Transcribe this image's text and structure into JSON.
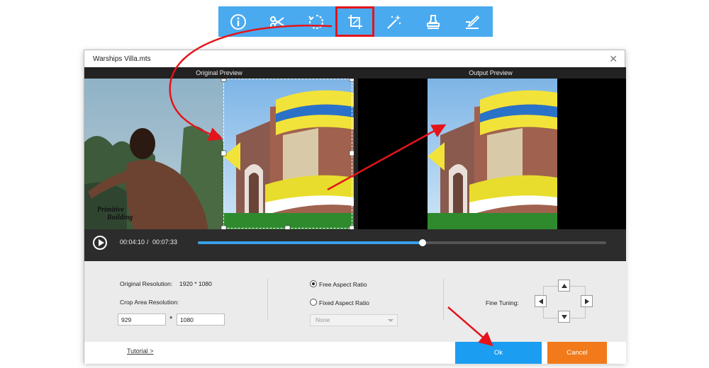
{
  "toolbar": {
    "tools": [
      {
        "icon": "info-icon"
      },
      {
        "icon": "scissors-icon"
      },
      {
        "icon": "rotate-icon"
      },
      {
        "icon": "crop-icon",
        "active": true
      },
      {
        "icon": "magic-wand-icon"
      },
      {
        "icon": "stamp-icon"
      },
      {
        "icon": "edit-subtitle-icon"
      }
    ],
    "bg_color": "#4aaaf0",
    "highlight_color": "#e4141a"
  },
  "dialog": {
    "title": "Warships Villa.mts",
    "close_glyph": "✕"
  },
  "preview": {
    "original_label": "Original Preview",
    "output_label": "Output Preview",
    "watermark_line1": "Primitive",
    "watermark_line2": "Building"
  },
  "playback": {
    "current_time": "00:04:10",
    "separator": "/",
    "total_time": "00:07:33",
    "progress": 0.55
  },
  "settings": {
    "original_resolution_label": "Original Resolution:",
    "original_resolution_value": "1920 * 1080",
    "crop_area_label": "Crop Area Resolution:",
    "crop_width": "929",
    "crop_times": "*",
    "crop_height": "1080",
    "free_aspect_label": "Free Aspect Ratio",
    "fixed_aspect_label": "Fixed Aspect Ratio",
    "aspect_select_value": "None",
    "selected_aspect": "free",
    "fine_tuning_label": "Fine Tuning:"
  },
  "footer": {
    "tutorial_label": "Tutorial >",
    "ok_label": "Ok",
    "cancel_label": "Cancel"
  },
  "colors": {
    "accent_blue": "#1b9df2",
    "cancel_orange": "#f27a1a",
    "annotation_red": "#e4141a"
  }
}
